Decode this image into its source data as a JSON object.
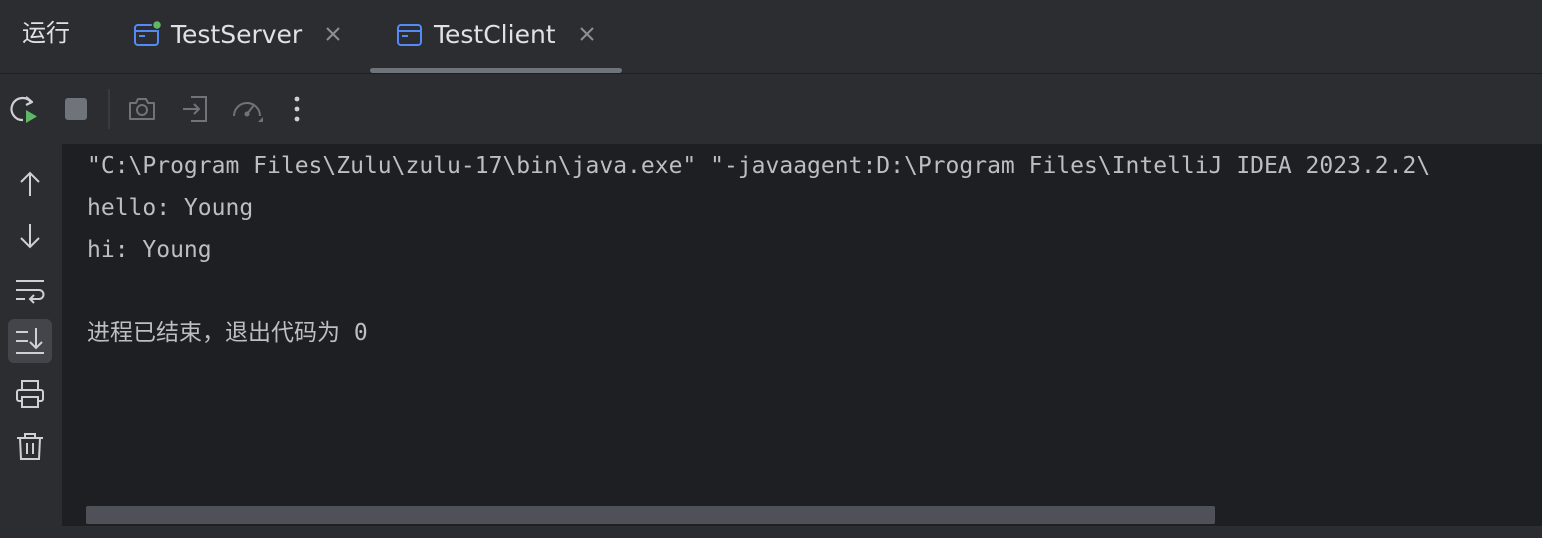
{
  "panel": {
    "title": "运行"
  },
  "tabs": [
    {
      "label": "TestServer",
      "icon": "console-window-icon",
      "running": true,
      "active": false
    },
    {
      "label": "TestClient",
      "icon": "console-window-icon",
      "running": false,
      "active": true
    }
  ],
  "toolbar": {
    "buttons": [
      "rerun-icon",
      "stop-icon",
      "screenshot-icon",
      "attach-icon",
      "profiler-icon",
      "more-icon"
    ]
  },
  "gutter": {
    "buttons": [
      "arrow-up-icon",
      "arrow-down-icon",
      "soft-wrap-icon",
      "scroll-to-end-icon",
      "print-icon",
      "trash-icon"
    ]
  },
  "console": {
    "command_line": "\"C:\\Program Files\\Zulu\\zulu-17\\bin\\java.exe\" \"-javaagent:D:\\Program Files\\IntelliJ IDEA 2023.2.2\\",
    "output": [
      "hello: Young",
      "hi: Young"
    ],
    "exit_message": "进程已结束，退出代码为 0"
  },
  "colors": {
    "background": "#1e1f22",
    "panel": "#2b2d30",
    "text": "#bcbec4",
    "running_dot": "#5fb865",
    "tab_icon": "#548af7"
  }
}
